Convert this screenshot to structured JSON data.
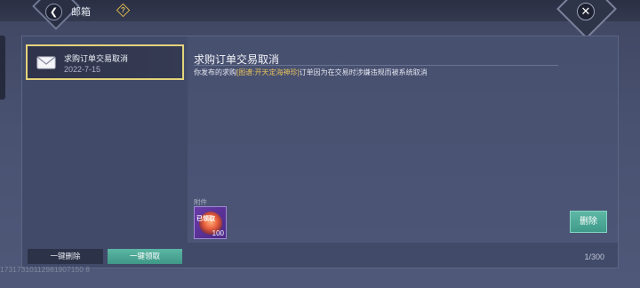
{
  "header": {
    "title": "邮箱",
    "back_icon": "back-arrow-icon",
    "help_icon_glyph": "?",
    "close_icon": "close-x-icon"
  },
  "mail_list": [
    {
      "subject": "求购订单交易取消",
      "date": "2022-7-15",
      "selected": true,
      "icon": "envelope-icon"
    }
  ],
  "mail_detail": {
    "title": "求购订单交易取消",
    "body_prefix": "你发布的求购",
    "body_highlight": "[图谱:开天定海神珍]",
    "body_suffix": "订单因为在交易时涉嫌违规而被系统取消",
    "highlight_color": "#e9c35d"
  },
  "attachment": {
    "label": "附件",
    "tag": "已领取",
    "quantity": "100"
  },
  "buttons": {
    "delete": "删除",
    "delete_all": "一键删除",
    "claim_all": "一键领取"
  },
  "footer": {
    "page_count": "1/300",
    "uid": "17317310112981907150 8"
  },
  "colors": {
    "accent_teal": "#4fa997",
    "selection_border": "#e4d37c"
  }
}
